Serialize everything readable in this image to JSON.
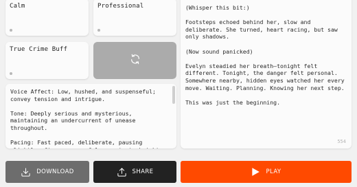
{
  "vibes": {
    "calm": "Calm",
    "professional": "Professional",
    "true_crime_buff": "True Crime Buff",
    "shuffle_icon": "refresh-icon"
  },
  "instructions": {
    "text": "Voice Affect: Low, hushed, and suspenseful; convey tension and intrigue.\n\nTone: Deeply serious and mysterious, maintaining an undercurrent of unease throughout.\n\nPacing: Fast paced, deliberate, pausing slightly after suspenseful moments to heighten drama."
  },
  "script": {
    "text": "(Whisper this bit:)\n\nFootsteps echoed behind her, slow and deliberate. She turned, heart racing, but saw only shadows.\n\n(Now sound panicked)\n\nEvelyn steadied her breath—tonight felt different. Tonight, the danger felt personal. Somewhere nearby, hidden eyes watched her every move. Waiting. Planning. Knowing her next step.\n\nThis was just the beginning.",
    "char_count": "554"
  },
  "actions": {
    "download": "DOWNLOAD",
    "share": "SHARE",
    "play": "PLAY"
  },
  "colors": {
    "play": "#ff4a00",
    "share": "#222222",
    "download": "#6d6d6d",
    "background": "#f1f1f1"
  }
}
